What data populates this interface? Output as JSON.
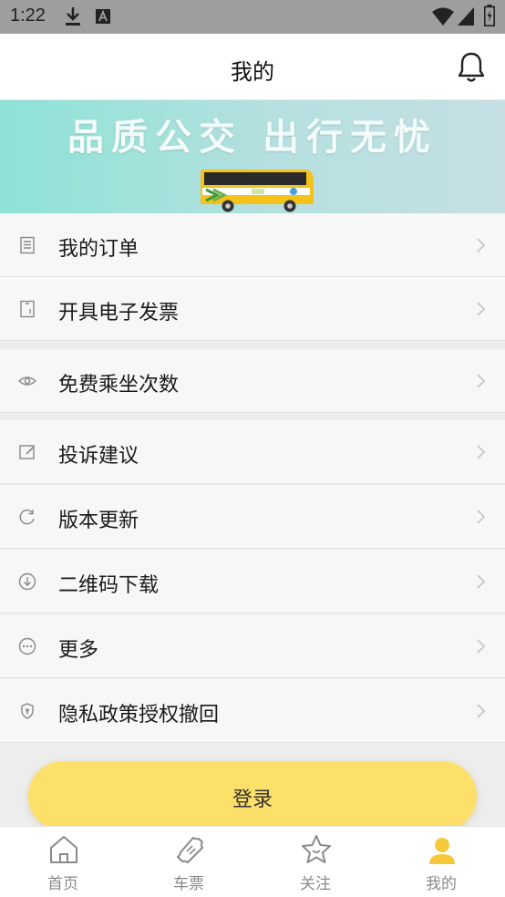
{
  "status_bar": {
    "time": "1:22"
  },
  "header": {
    "title": "我的"
  },
  "banner": {
    "slogan": "品质公交 出行无忧"
  },
  "menu": [
    {
      "label": "我的订单",
      "icon": "order-list-icon"
    },
    {
      "label": "开具电子发票",
      "icon": "receipt-icon"
    },
    {
      "label": "免费乘坐次数",
      "icon": "eye-icon"
    },
    {
      "label": "投诉建议",
      "icon": "edit-icon"
    },
    {
      "label": "版本更新",
      "icon": "refresh-icon"
    },
    {
      "label": "二维码下载",
      "icon": "download-circle-icon"
    },
    {
      "label": "更多",
      "icon": "more-icon"
    },
    {
      "label": "隐私政策授权撤回",
      "icon": "shield-icon"
    }
  ],
  "login": {
    "label": "登录"
  },
  "tabs": [
    {
      "label": "首页",
      "icon": "home-icon"
    },
    {
      "label": "车票",
      "icon": "ticket-icon"
    },
    {
      "label": "关注",
      "icon": "star-icon"
    },
    {
      "label": "我的",
      "icon": "user-icon",
      "active": true
    }
  ],
  "colors": {
    "accent": "#fde06a",
    "active_tab_icon": "#f6c93b",
    "background": "#ededed"
  }
}
